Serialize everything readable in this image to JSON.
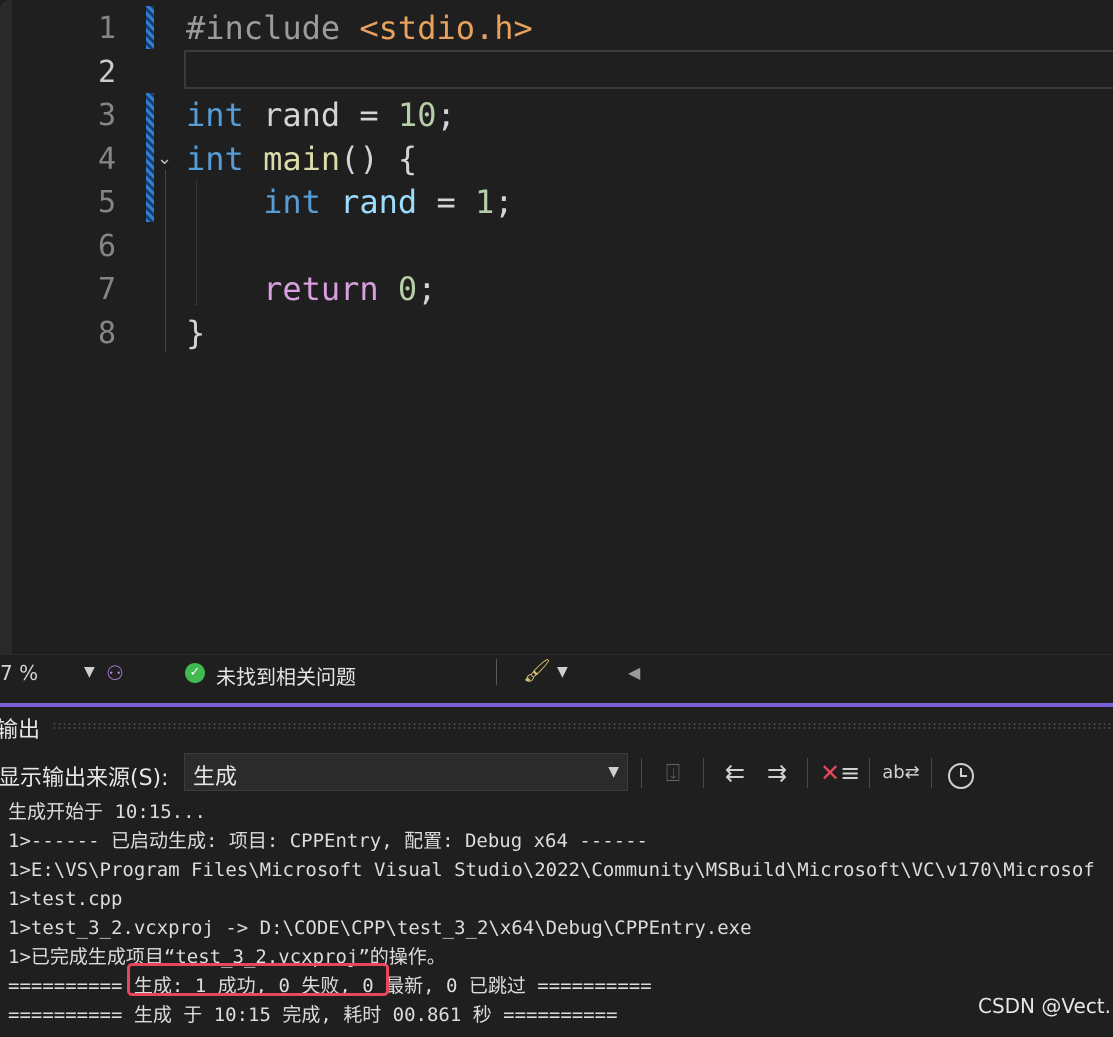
{
  "editor": {
    "lines": [
      {
        "num": "1",
        "tokens": [
          {
            "c": "pre",
            "t": "#include "
          },
          {
            "c": "str",
            "t": "<stdio.h>"
          }
        ]
      },
      {
        "num": "2",
        "tokens": []
      },
      {
        "num": "3",
        "tokens": [
          {
            "c": "kw",
            "t": "int"
          },
          {
            "c": "ident",
            "t": " rand = "
          },
          {
            "c": "num",
            "t": "10"
          },
          {
            "c": "ident",
            "t": ";"
          }
        ]
      },
      {
        "num": "4",
        "tokens": [
          {
            "c": "kw",
            "t": "int"
          },
          {
            "c": "ident",
            "t": " "
          },
          {
            "c": "fn",
            "t": "main"
          },
          {
            "c": "ident",
            "t": "() {"
          }
        ]
      },
      {
        "num": "5",
        "tokens": [
          {
            "c": "ident",
            "t": "    "
          },
          {
            "c": "kw",
            "t": "int"
          },
          {
            "c": "ident",
            "t": " "
          },
          {
            "c": "var",
            "t": "rand"
          },
          {
            "c": "ident",
            "t": " = "
          },
          {
            "c": "num",
            "t": "1"
          },
          {
            "c": "ident",
            "t": ";"
          }
        ]
      },
      {
        "num": "6",
        "tokens": []
      },
      {
        "num": "7",
        "tokens": [
          {
            "c": "ident",
            "t": "    "
          },
          {
            "c": "kw2",
            "t": "return"
          },
          {
            "c": "ident",
            "t": " "
          },
          {
            "c": "num",
            "t": "0"
          },
          {
            "c": "ident",
            "t": ";"
          }
        ]
      },
      {
        "num": "8",
        "tokens": [
          {
            "c": "ident",
            "t": "}"
          }
        ]
      }
    ],
    "active_line": "2"
  },
  "status": {
    "zoom": "7 %",
    "issues_text": "未找到相关问题"
  },
  "output": {
    "title": "输出",
    "source_label": "显示输出来源(S):",
    "source_value": "生成",
    "lines": [
      "生成开始于 10:15...",
      "1>------ 已启动生成: 项目: CPPEntry, 配置: Debug x64 ------",
      "1>E:\\VS\\Program Files\\Microsoft Visual Studio\\2022\\Community\\MSBuild\\Microsoft\\VC\\v170\\Microsof",
      "1>test.cpp",
      "1>test_3_2.vcxproj -> D:\\CODE\\CPP\\test_3_2\\x64\\Debug\\CPPEntry.exe",
      "1>已完成生成项目“test_3_2.vcxproj”的操作。",
      "========== 生成: 1 成功, 0 失败, 0 最新, 0 已跳过 ==========",
      "========== 生成 于 10:15 完成, 耗时 00.861 秒 =========="
    ]
  },
  "watermark": "CSDN @Vect."
}
